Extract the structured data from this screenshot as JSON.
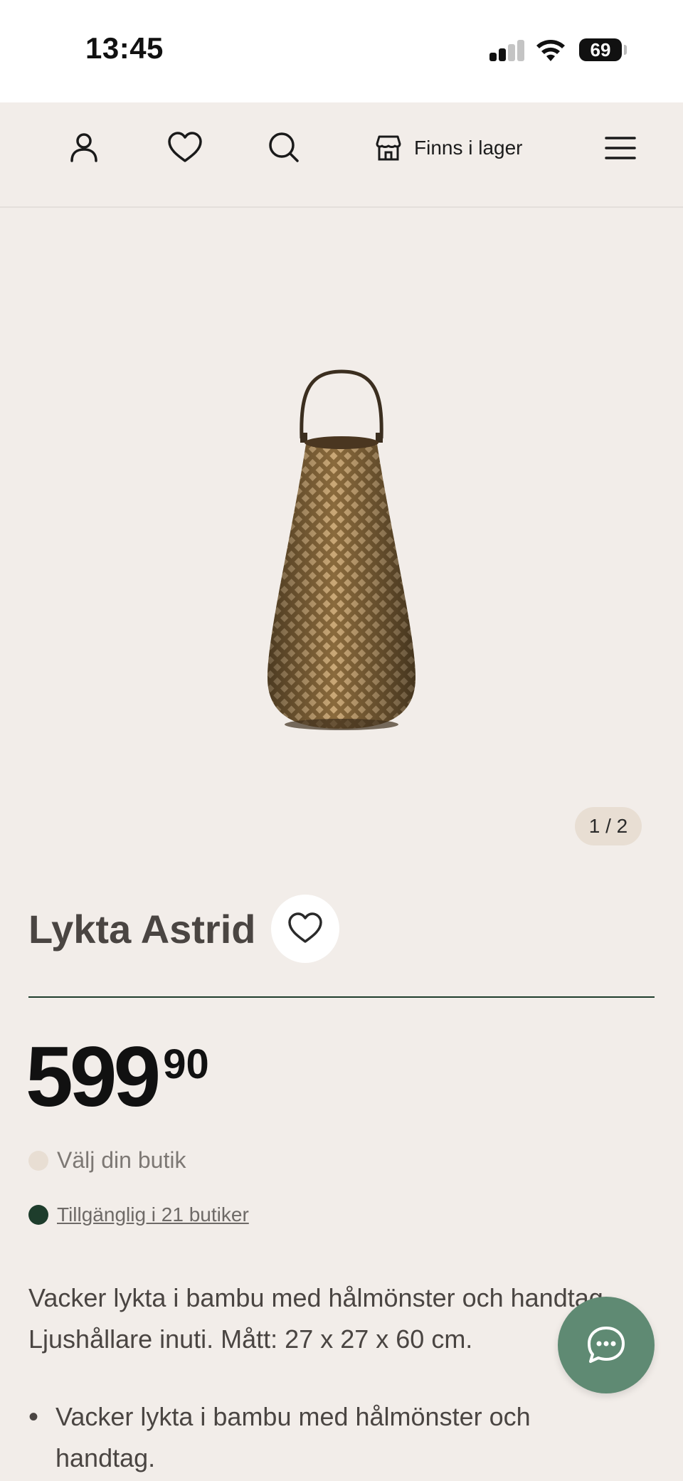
{
  "status_bar": {
    "time": "13:45",
    "battery": "69",
    "icons": [
      "signal-icon",
      "wifi-icon",
      "battery-icon"
    ]
  },
  "nav": {
    "icons": [
      "user-icon",
      "heart-icon",
      "search-icon",
      "store-icon",
      "menu-icon"
    ],
    "stock_label": "Finns i lager"
  },
  "gallery": {
    "counter": "1 / 2"
  },
  "product": {
    "title": "Lykta Astrid",
    "price_main": "599",
    "price_cents": "90",
    "store_select": "Välj din butik",
    "availability": "Tillgänglig i 21 butiker",
    "description": "Vacker lykta i bambu med hålmönster och handtag. Ljushållare inuti. Mått: 27 x 27 x 60 cm.",
    "bullets": [
      "Vacker lykta i bambu med hålmönster och handtag."
    ]
  },
  "colors": {
    "background": "#f2ede9",
    "accent_green": "#1e3d2c",
    "chat_button": "#5f8a73",
    "store_dot": "#e8ded3"
  }
}
